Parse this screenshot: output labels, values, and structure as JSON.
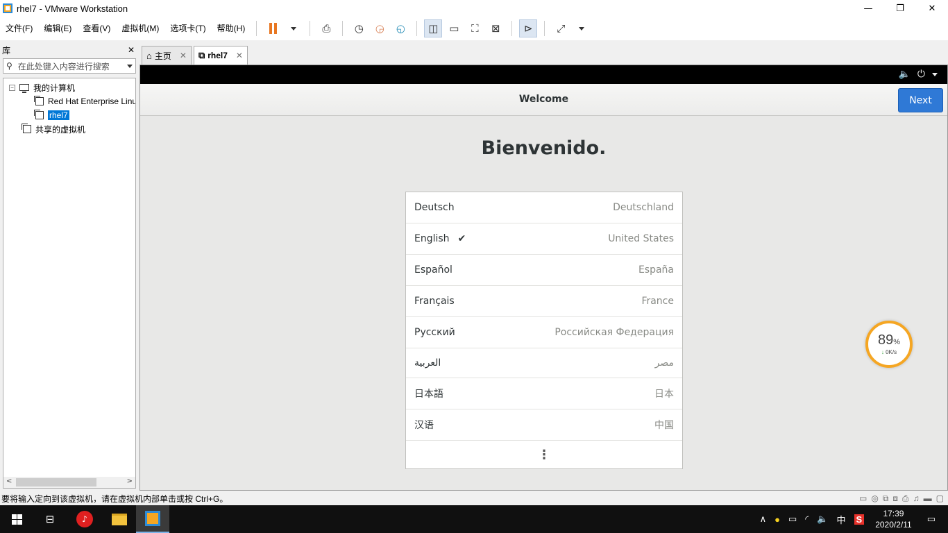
{
  "window": {
    "title": "rhel7 - VMware Workstation",
    "minimize": "—",
    "maximize": "❐",
    "close": "✕"
  },
  "menu": [
    "文件(F)",
    "编辑(E)",
    "查看(V)",
    "虚拟机(M)",
    "选项卡(T)",
    "帮助(H)"
  ],
  "library": {
    "title": "库",
    "close": "✕",
    "search_placeholder": "在此处键入内容进行搜索",
    "tree": {
      "my_computer": "我的计算机",
      "vm1": "Red Hat Enterprise Linux",
      "vm2": "rhel7",
      "shared": "共享的虚拟机"
    }
  },
  "tabs": [
    {
      "label": "主页",
      "close": "✕"
    },
    {
      "label": "rhel7",
      "close": "✕"
    }
  ],
  "guest": {
    "header_title": "Welcome",
    "next_label": "Next",
    "heading": "Bienvenido.",
    "languages": [
      {
        "name": "Deutsch",
        "region": "Deutschland",
        "checked": false
      },
      {
        "name": "English",
        "region": "United States",
        "checked": true
      },
      {
        "name": "Español",
        "region": "España",
        "checked": false
      },
      {
        "name": "Français",
        "region": "France",
        "checked": false
      },
      {
        "name": "Русский",
        "region": "Российская Федерация",
        "checked": false
      },
      {
        "name": "العربية",
        "region": "مصر",
        "checked": false
      },
      {
        "name": "日本語",
        "region": "日本",
        "checked": false
      },
      {
        "name": "汉语",
        "region": "中国",
        "checked": false
      }
    ],
    "more": "⋮"
  },
  "speed_widget": {
    "percent": "89",
    "unit": "%",
    "rate": "0K/s"
  },
  "statusbar": {
    "message": "要将输入定向到该虚拟机，请在虚拟机内部单击或按 Ctrl+G。"
  },
  "taskbar": {
    "ime": "中",
    "time": "17:39",
    "date": "2020/2/11"
  },
  "colors": {
    "accent": "#2f79d6",
    "vmware_orange": "#e87722",
    "speed_ring": "#f5a623"
  }
}
